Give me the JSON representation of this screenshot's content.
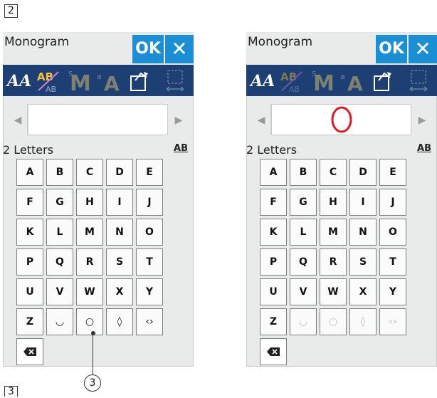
{
  "figure": {
    "step_label_top": "2",
    "step_label_bottom": "3",
    "callout_number": "3"
  },
  "panels": [
    {
      "title": "Monogram",
      "ok_label": "OK",
      "close_symbol": "✕",
      "letters_label": "2 Letters",
      "ab_label": "AB",
      "text_value": "",
      "keys": [
        "A",
        "B",
        "C",
        "D",
        "E",
        "F",
        "G",
        "H",
        "I",
        "J",
        "K",
        "L",
        "M",
        "N",
        "O",
        "P",
        "Q",
        "R",
        "S",
        "T",
        "U",
        "V",
        "W",
        "X",
        "Y",
        "Z",
        "◡",
        "○",
        "◊",
        "‹›"
      ],
      "delete_icon": "backspace-icon",
      "accent_color": "#1b8fd6",
      "toolbar_color": "#1d3f74"
    },
    {
      "title": "Monogram",
      "ok_label": "OK",
      "close_symbol": "✕",
      "letters_label": "2 Letters",
      "ab_label": "AB",
      "text_value": "O",
      "keys": [
        "A",
        "B",
        "C",
        "D",
        "E",
        "F",
        "G",
        "H",
        "I",
        "J",
        "K",
        "L",
        "M",
        "N",
        "O",
        "P",
        "Q",
        "R",
        "S",
        "T",
        "U",
        "V",
        "W",
        "X",
        "Y",
        "Z",
        "◡",
        "○",
        "◊",
        "‹›"
      ],
      "delete_icon": "backspace-icon",
      "accent_color": "#1b8fd6",
      "toolbar_color": "#1d3f74"
    }
  ]
}
